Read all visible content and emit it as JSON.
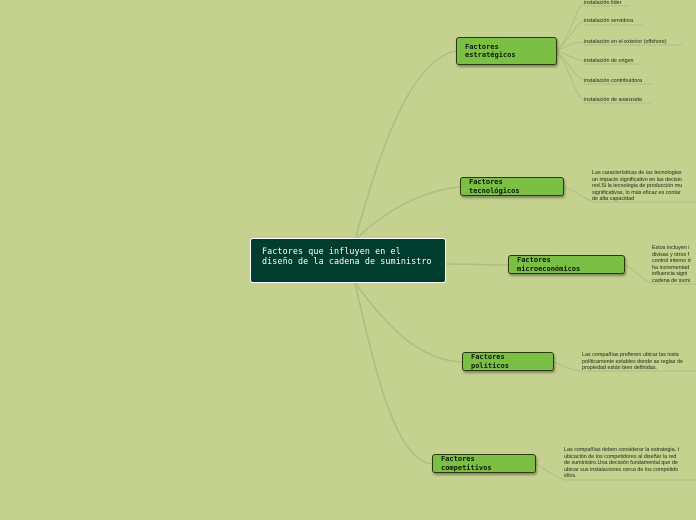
{
  "central": "Factores que influyen en el diseño de la cadena de suministro",
  "topics": {
    "estrategicos": {
      "label": "Factores estratégicos",
      "children": [
        "instalación líder",
        "instalación servidora",
        "instalación en el exterior (offshore)",
        "instalación de origen",
        "instalación contribuidora",
        "instalación de avanzada"
      ]
    },
    "tecnologicos": {
      "label": "Factores tecnológicos",
      "text": "Las características de las tecnologias\nun impacto significativo en las decisio\nred.Si la tecnologia de producción mu\nsignificativas, lo más eficaz es contar\nde alta capacidad"
    },
    "microeconomicos": {
      "label": "Factores microeconómicos",
      "text": "Estos incluyen i\ndivisas y otros f\ncontrol interno d\nha incrementad\ninfluencia signi\ncadena de sumi"
    },
    "politicos": {
      "label": "Factores políticos",
      "text": "Las compañías prefieren ubicar las insta\npolíticamente estables donde as reglas de\npropiedad están bien definidas."
    },
    "competitivos": {
      "label": "Factores competitivos",
      "text": "Las compañías deben considerar la estrategia, t\nubicación de los competidores al diseñar la red\nde suministro.Una decisión fundamental que de\nubicar sus instalaciones cerca de los competido\nellos."
    }
  },
  "colors": {
    "background": "#c5d18f",
    "central_fill": "#003d2e",
    "topic_fill": "#7bbf45",
    "connector": "#aebd88"
  }
}
